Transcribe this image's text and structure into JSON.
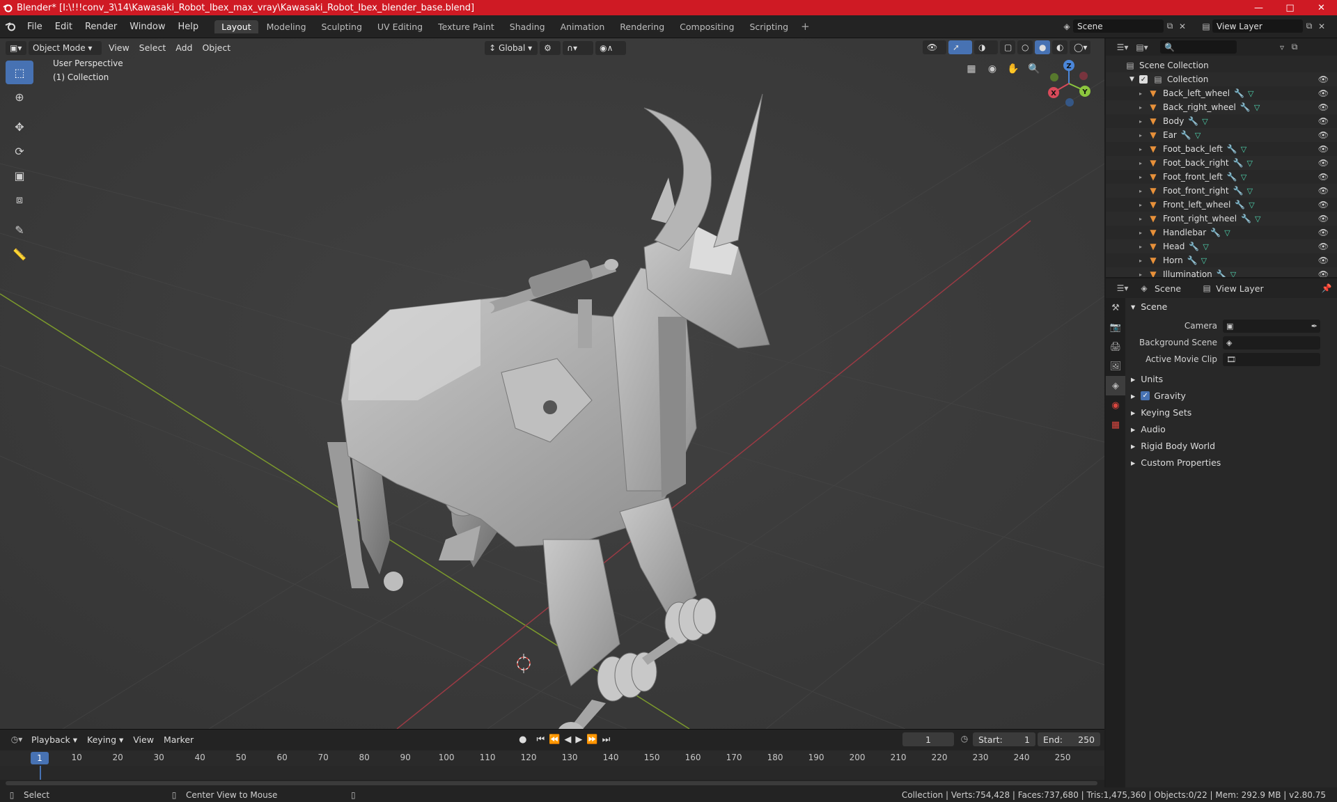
{
  "window": {
    "title": "Blender* [I:\\!!!conv_3\\14\\Kawasaki_Robot_Ibex_max_vray\\Kawasaki_Robot_Ibex_blender_base.blend]"
  },
  "menus": [
    "File",
    "Edit",
    "Render",
    "Window",
    "Help"
  ],
  "workspaces": [
    "Layout",
    "Modeling",
    "Sculpting",
    "UV Editing",
    "Texture Paint",
    "Shading",
    "Animation",
    "Rendering",
    "Compositing",
    "Scripting"
  ],
  "active_workspace": "Layout",
  "scene_name": "Scene",
  "view_layer_name": "View Layer",
  "viewport": {
    "mode": "Object Mode",
    "menus": [
      "View",
      "Select",
      "Add",
      "Object"
    ],
    "orientation": "Global",
    "perspective_label": "User Perspective",
    "collection_label": "(1) Collection",
    "gizmo_axes": {
      "x": "X",
      "y": "Y",
      "z": "Z"
    }
  },
  "outliner": {
    "root": "Scene Collection",
    "collection": "Collection",
    "objects": [
      "Back_left_wheel",
      "Back_right_wheel",
      "Body",
      "Ear",
      "Foot_back_left",
      "Foot_back_right",
      "Foot_front_left",
      "Foot_front_right",
      "Front_left_wheel",
      "Front_right_wheel",
      "Handlebar",
      "Head",
      "Horn",
      "Illumination"
    ]
  },
  "properties": {
    "tab_scene": "Scene",
    "tab_view_layer": "View Layer",
    "panel": "Scene",
    "fields": [
      {
        "label": "Camera",
        "value": ""
      },
      {
        "label": "Background Scene",
        "value": ""
      },
      {
        "label": "Active Movie Clip",
        "value": ""
      }
    ],
    "subpanels": [
      "Units",
      "Gravity",
      "Keying Sets",
      "Audio",
      "Rigid Body World",
      "Custom Properties"
    ],
    "gravity_checked": true
  },
  "timeline": {
    "menus": [
      "Playback",
      "Keying",
      "View",
      "Marker"
    ],
    "current_frame": "1",
    "start_label": "Start:",
    "start": "1",
    "end_label": "End:",
    "end": "250",
    "ruler": [
      "1",
      "10",
      "20",
      "30",
      "40",
      "50",
      "60",
      "70",
      "80",
      "90",
      "100",
      "110",
      "120",
      "130",
      "140",
      "150",
      "160",
      "170",
      "180",
      "190",
      "200",
      "210",
      "220",
      "230",
      "240",
      "250"
    ]
  },
  "status": {
    "select": "Select",
    "center": "Center View to Mouse",
    "stats": "Collection | Verts:754,428 | Faces:737,680 | Tris:1,475,360 | Objects:0/22 | Mem: 292.9 MB | v2.80.75"
  },
  "colors": {
    "title_bar": "#cf1a24",
    "accent": "#4772b3",
    "x_axis": "#d94a5a",
    "y_axis": "#8cc63e",
    "z_axis": "#4a86d9"
  }
}
